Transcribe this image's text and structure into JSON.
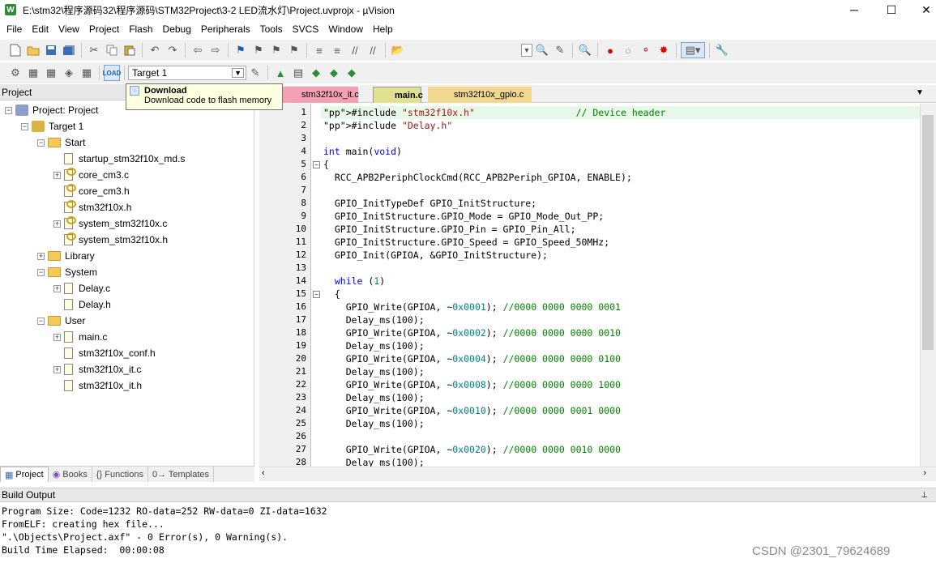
{
  "window": {
    "title": "E:\\stm32\\程序源码32\\程序源码\\STM32Project\\3-2 LED流水灯\\Project.uvprojx - µVision",
    "app_icon": "W",
    "minimize": "─",
    "maximize": "☐",
    "close": "✕"
  },
  "menu": [
    "File",
    "Edit",
    "View",
    "Project",
    "Flash",
    "Debug",
    "Peripherals",
    "Tools",
    "SVCS",
    "Window",
    "Help"
  ],
  "toolbar2": {
    "target_select": "Target 1"
  },
  "tooltip": {
    "title": "Download",
    "desc": "Download code to flash memory"
  },
  "project_panel": {
    "header": "Project",
    "tree": [
      {
        "label": "Project: Project",
        "depth": 0,
        "kind": "project",
        "exp": "−"
      },
      {
        "label": "Target 1",
        "depth": 1,
        "kind": "target",
        "exp": "−"
      },
      {
        "label": "Start",
        "depth": 2,
        "kind": "folder",
        "exp": "−"
      },
      {
        "label": "startup_stm32f10x_md.s",
        "depth": 3,
        "kind": "file",
        "exp": ""
      },
      {
        "label": "core_cm3.c",
        "depth": 3,
        "kind": "filemod",
        "exp": "+"
      },
      {
        "label": "core_cm3.h",
        "depth": 3,
        "kind": "filemod",
        "exp": ""
      },
      {
        "label": "stm32f10x.h",
        "depth": 3,
        "kind": "filemod",
        "exp": ""
      },
      {
        "label": "system_stm32f10x.c",
        "depth": 3,
        "kind": "filemod",
        "exp": "+"
      },
      {
        "label": "system_stm32f10x.h",
        "depth": 3,
        "kind": "filemod",
        "exp": ""
      },
      {
        "label": "Library",
        "depth": 2,
        "kind": "folder",
        "exp": "+"
      },
      {
        "label": "System",
        "depth": 2,
        "kind": "folder",
        "exp": "−"
      },
      {
        "label": "Delay.c",
        "depth": 3,
        "kind": "file",
        "exp": "+"
      },
      {
        "label": "Delay.h",
        "depth": 3,
        "kind": "file",
        "exp": ""
      },
      {
        "label": "User",
        "depth": 2,
        "kind": "folder",
        "exp": "−"
      },
      {
        "label": "main.c",
        "depth": 3,
        "kind": "file",
        "exp": "+"
      },
      {
        "label": "stm32f10x_conf.h",
        "depth": 3,
        "kind": "file",
        "exp": ""
      },
      {
        "label": "stm32f10x_it.c",
        "depth": 3,
        "kind": "file",
        "exp": "+"
      },
      {
        "label": "stm32f10x_it.h",
        "depth": 3,
        "kind": "file",
        "exp": ""
      }
    ],
    "bottom_tabs": [
      "Project",
      "Books",
      "{} Functions",
      "0→ Templates"
    ]
  },
  "editor": {
    "tabs": [
      {
        "label": "stm32f10x_it.c",
        "color": "#f4a0b4"
      },
      {
        "label": "main.c",
        "color": "#e0e090"
      },
      {
        "label": "stm32f10x_gpio.c",
        "color": "#f0d890"
      }
    ],
    "line_numbers": [
      "1",
      "2",
      "3",
      "4",
      "5",
      "6",
      "7",
      "8",
      "9",
      "10",
      "11",
      "12",
      "13",
      "14",
      "15",
      "16",
      "17",
      "18",
      "19",
      "20",
      "21",
      "22",
      "23",
      "24",
      "25",
      "26",
      "27",
      "28"
    ],
    "lines": [
      "#include \"stm32f10x.h\"                  // Device header",
      "#include \"Delay.h\"",
      "",
      "int main(void)",
      "{",
      "  RCC_APB2PeriphClockCmd(RCC_APB2Periph_GPIOA, ENABLE);",
      "",
      "  GPIO_InitTypeDef GPIO_InitStructure;",
      "  GPIO_InitStructure.GPIO_Mode = GPIO_Mode_Out_PP;",
      "  GPIO_InitStructure.GPIO_Pin = GPIO_Pin_All;",
      "  GPIO_InitStructure.GPIO_Speed = GPIO_Speed_50MHz;",
      "  GPIO_Init(GPIOA, &GPIO_InitStructure);",
      "",
      "  while (1)",
      "  {",
      "    GPIO_Write(GPIOA, ~0x0001); //0000 0000 0000 0001",
      "    Delay_ms(100);",
      "    GPIO_Write(GPIOA, ~0x0002); //0000 0000 0000 0010",
      "    Delay_ms(100);",
      "    GPIO_Write(GPIOA, ~0x0004); //0000 0000 0000 0100",
      "    Delay_ms(100);",
      "    GPIO_Write(GPIOA, ~0x0008); //0000 0000 0000 1000",
      "    Delay_ms(100);",
      "    GPIO_Write(GPIOA, ~0x0010); //0000 0000 0001 0000",
      "    Delay_ms(100);",
      "",
      "    GPIO_Write(GPIOA, ~0x0020); //0000 0000 0010 0000",
      "    Delay_ms(100);"
    ]
  },
  "build_output": {
    "header": "Build Output",
    "lines": [
      "Program Size: Code=1232 RO-data=252 RW-data=0 ZI-data=1632",
      "FromELF: creating hex file...",
      "\".\\Objects\\Project.axf\" - 0 Error(s), 0 Warning(s).",
      "Build Time Elapsed:  00:00:08"
    ]
  },
  "watermark": "CSDN @2301_79624689"
}
